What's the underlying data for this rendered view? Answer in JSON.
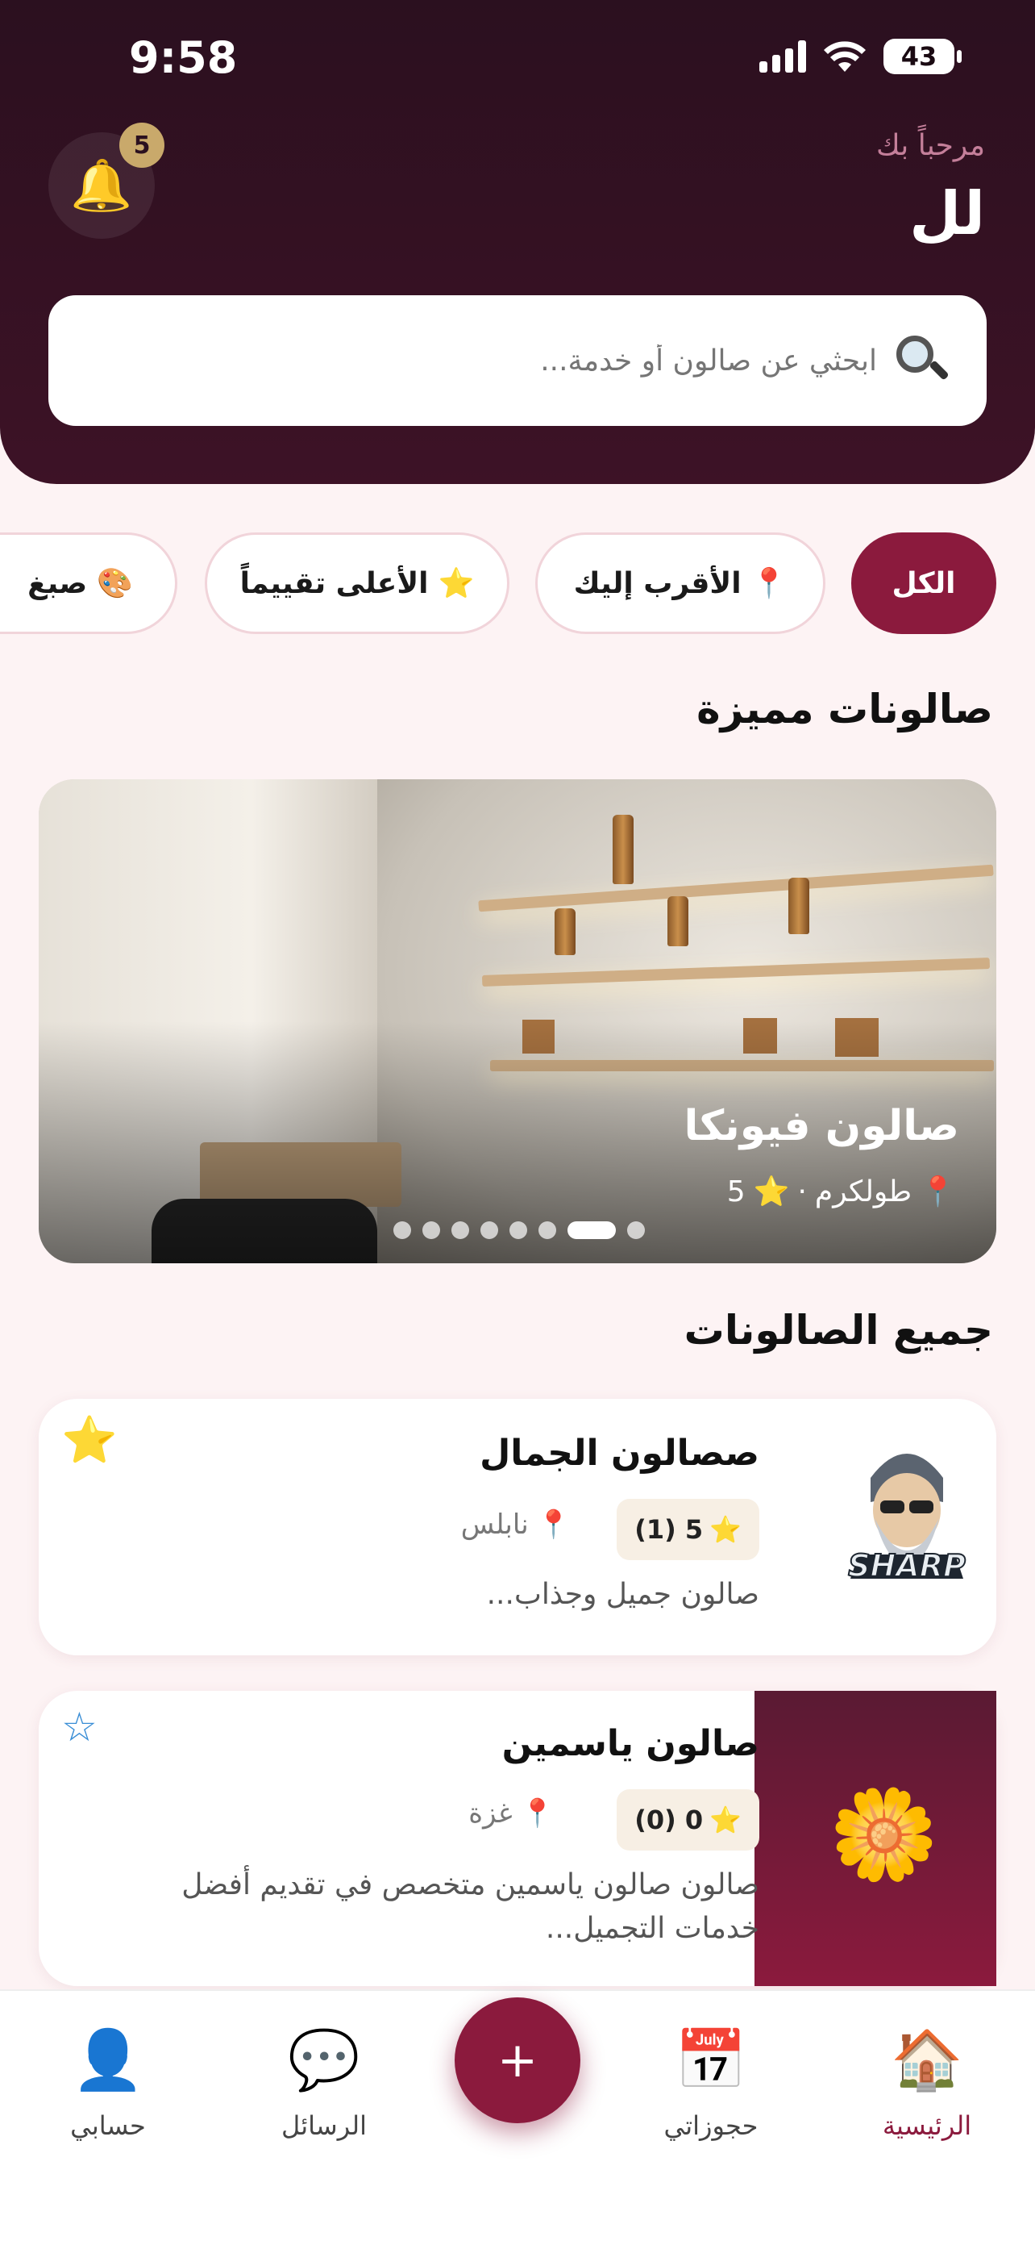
{
  "status": {
    "time": "9:58",
    "battery": "43"
  },
  "header": {
    "welcome": "مرحباً بك",
    "username": "لل",
    "notifications_count": "5",
    "bell_icon": "bell-icon"
  },
  "search": {
    "placeholder": "ابحثي عن صالون أو خدمة..."
  },
  "filters": [
    {
      "label": "الكل",
      "icon": ""
    },
    {
      "label": "الأقرب إليك",
      "icon": "📍"
    },
    {
      "label": "الأعلى تقييماً",
      "icon": "⭐"
    },
    {
      "label": "صبغ",
      "icon": "🎨"
    }
  ],
  "featured": {
    "title": "صالونات مميزة",
    "name": "صالون فيونكا",
    "location": "طولكرم",
    "rating": "5",
    "slide_count": 8,
    "active_slide": 6
  },
  "all_salons": {
    "title": "جميع الصالونات",
    "items": [
      {
        "name": "صصالون الجمال",
        "rating": "5 (1)",
        "location": "نابلس",
        "description": "صالون جميل وجذاب...",
        "favorite": true,
        "logo_text": "SHARP"
      },
      {
        "name": "صالون ياسمين",
        "rating": "0 (0)",
        "location": "غزة",
        "description": "صالون صالون ياسمين متخصص في تقديم أفضل خدمات التجميل...",
        "favorite": false,
        "logo_icon": "🌼"
      }
    ]
  },
  "nav": {
    "home": "الرئيسية",
    "bookings": "حجوزاتي",
    "add": "+",
    "messages": "الرسائل",
    "account": "حسابي"
  },
  "colors": {
    "primary": "#8b1a3d",
    "header": "#2b101f",
    "background": "#fdf3f4",
    "badge": "#c9a96b"
  }
}
